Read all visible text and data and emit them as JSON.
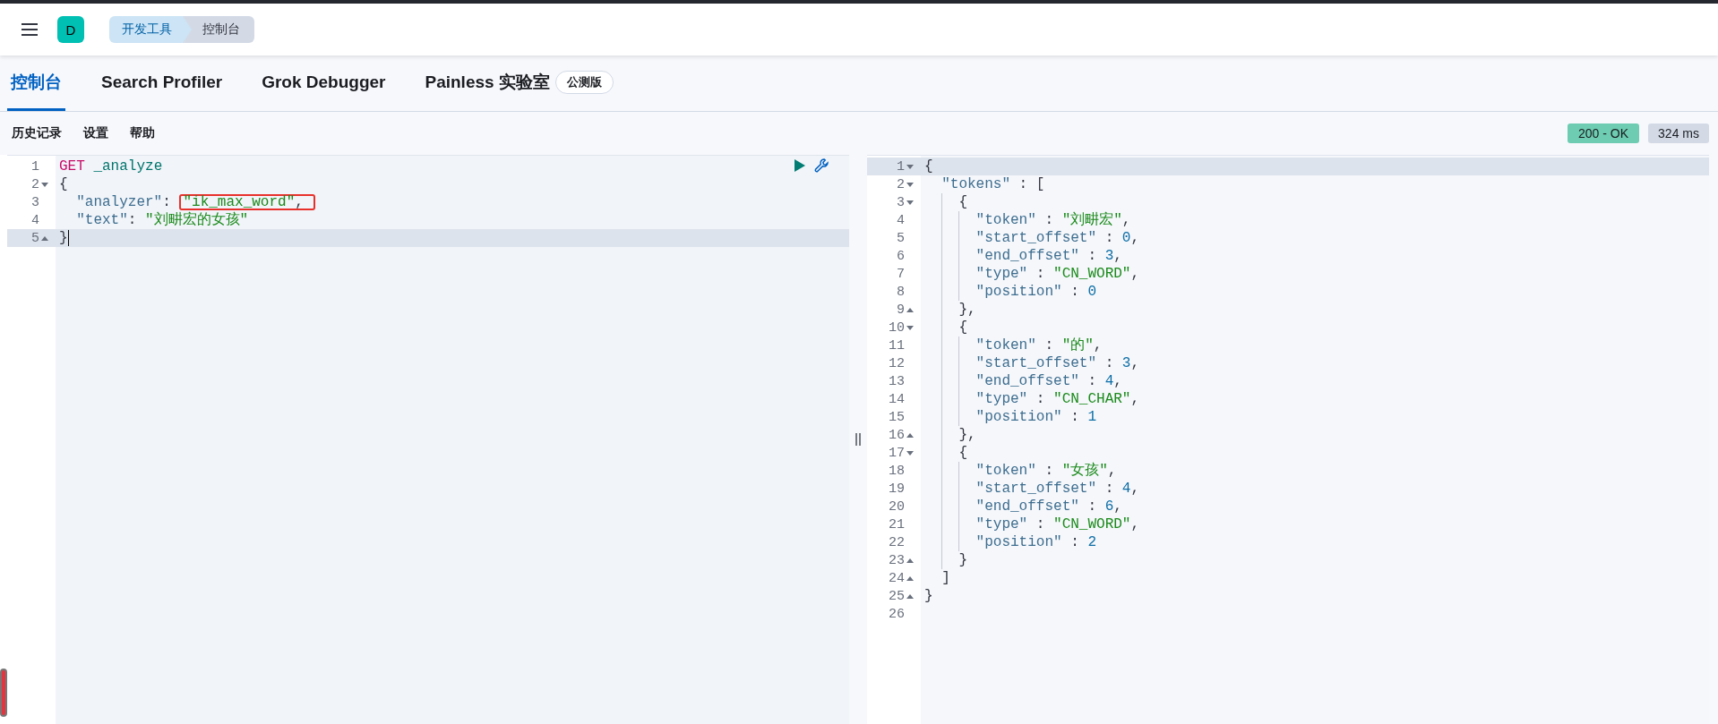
{
  "header": {
    "avatar": "D",
    "breadcrumbs": [
      {
        "label": "开发工具",
        "selected": false
      },
      {
        "label": "控制台",
        "selected": true
      }
    ]
  },
  "tabs": [
    {
      "label": "控制台",
      "selected": true
    },
    {
      "label": "Search Profiler",
      "selected": false
    },
    {
      "label": "Grok Debugger",
      "selected": false
    },
    {
      "label": "Painless 实验室",
      "selected": false,
      "badge": "公测版"
    }
  ],
  "toolbar": {
    "links": [
      "历史记录",
      "设置",
      "帮助"
    ],
    "status": "200 - OK",
    "time": "324 ms"
  },
  "request": {
    "lines": [
      {
        "number": "1",
        "fold": false,
        "active": false,
        "cursor": false,
        "tokens": [
          {
            "text": "GET",
            "kind": "method"
          },
          {
            "text": " _analyze",
            "kind": "path"
          }
        ]
      },
      {
        "number": "2",
        "fold": true,
        "block_start": true,
        "active": false,
        "cursor": false,
        "tokens": [
          {
            "text": "{",
            "kind": "punct"
          }
        ]
      },
      {
        "number": "3",
        "fold": false,
        "active": false,
        "cursor": false,
        "tokens": [
          {
            "text": "  \"analyzer\"",
            "kind": "key"
          },
          {
            "text": ": ",
            "kind": "punct"
          },
          {
            "text": "\"ik_max_word\"",
            "kind": "string",
            "boxed": true
          },
          {
            "text": ", ",
            "kind": "punct",
            "boxed": true
          }
        ]
      },
      {
        "number": "4",
        "fold": false,
        "active": false,
        "cursor": false,
        "tokens": [
          {
            "text": "  \"text\"",
            "kind": "key"
          },
          {
            "text": ": ",
            "kind": "punct"
          },
          {
            "text": "\"刘畊宏的女孩\"",
            "kind": "string"
          }
        ]
      },
      {
        "number": "5",
        "fold": true,
        "block_start": false,
        "active": true,
        "cursor": true,
        "tokens": [
          {
            "text": "}",
            "kind": "punct"
          }
        ]
      }
    ]
  },
  "response": {
    "lines": [
      {
        "number": "1",
        "fold": true,
        "block_start": true,
        "active": true,
        "tokens": [
          {
            "text": "{",
            "kind": "punct"
          }
        ]
      },
      {
        "number": "2",
        "fold": true,
        "block_start": true,
        "active": false,
        "tokens": [
          {
            "text": "  \"tokens\"",
            "kind": "key"
          },
          {
            "text": " : [",
            "kind": "punct"
          }
        ]
      },
      {
        "number": "3",
        "fold": true,
        "block_start": true,
        "active": false,
        "tokens": [
          {
            "text": "    {",
            "kind": "punct"
          }
        ]
      },
      {
        "number": "4",
        "fold": false,
        "active": false,
        "tokens": [
          {
            "text": "      \"token\"",
            "kind": "key"
          },
          {
            "text": " : ",
            "kind": "punct"
          },
          {
            "text": "\"刘畊宏\"",
            "kind": "string"
          },
          {
            "text": ",",
            "kind": "punct"
          }
        ]
      },
      {
        "number": "5",
        "fold": false,
        "active": false,
        "tokens": [
          {
            "text": "      \"start_offset\"",
            "kind": "key"
          },
          {
            "text": " : ",
            "kind": "punct"
          },
          {
            "text": "0",
            "kind": "number"
          },
          {
            "text": ",",
            "kind": "punct"
          }
        ]
      },
      {
        "number": "6",
        "fold": false,
        "active": false,
        "tokens": [
          {
            "text": "      \"end_offset\"",
            "kind": "key"
          },
          {
            "text": " : ",
            "kind": "punct"
          },
          {
            "text": "3",
            "kind": "number"
          },
          {
            "text": ",",
            "kind": "punct"
          }
        ]
      },
      {
        "number": "7",
        "fold": false,
        "active": false,
        "tokens": [
          {
            "text": "      \"type\"",
            "kind": "key"
          },
          {
            "text": " : ",
            "kind": "punct"
          },
          {
            "text": "\"CN_WORD\"",
            "kind": "string"
          },
          {
            "text": ",",
            "kind": "punct"
          }
        ]
      },
      {
        "number": "8",
        "fold": false,
        "active": false,
        "tokens": [
          {
            "text": "      \"position\"",
            "kind": "key"
          },
          {
            "text": " : ",
            "kind": "punct"
          },
          {
            "text": "0",
            "kind": "number"
          }
        ]
      },
      {
        "number": "9",
        "fold": true,
        "block_start": false,
        "active": false,
        "tokens": [
          {
            "text": "    },",
            "kind": "punct"
          }
        ]
      },
      {
        "number": "10",
        "fold": true,
        "block_start": true,
        "active": false,
        "tokens": [
          {
            "text": "    {",
            "kind": "punct"
          }
        ]
      },
      {
        "number": "11",
        "fold": false,
        "active": false,
        "tokens": [
          {
            "text": "      \"token\"",
            "kind": "key"
          },
          {
            "text": " : ",
            "kind": "punct"
          },
          {
            "text": "\"的\"",
            "kind": "string"
          },
          {
            "text": ",",
            "kind": "punct"
          }
        ]
      },
      {
        "number": "12",
        "fold": false,
        "active": false,
        "tokens": [
          {
            "text": "      \"start_offset\"",
            "kind": "key"
          },
          {
            "text": " : ",
            "kind": "punct"
          },
          {
            "text": "3",
            "kind": "number"
          },
          {
            "text": ",",
            "kind": "punct"
          }
        ]
      },
      {
        "number": "13",
        "fold": false,
        "active": false,
        "tokens": [
          {
            "text": "      \"end_offset\"",
            "kind": "key"
          },
          {
            "text": " : ",
            "kind": "punct"
          },
          {
            "text": "4",
            "kind": "number"
          },
          {
            "text": ",",
            "kind": "punct"
          }
        ]
      },
      {
        "number": "14",
        "fold": false,
        "active": false,
        "tokens": [
          {
            "text": "      \"type\"",
            "kind": "key"
          },
          {
            "text": " : ",
            "kind": "punct"
          },
          {
            "text": "\"CN_CHAR\"",
            "kind": "string"
          },
          {
            "text": ",",
            "kind": "punct"
          }
        ]
      },
      {
        "number": "15",
        "fold": false,
        "active": false,
        "tokens": [
          {
            "text": "      \"position\"",
            "kind": "key"
          },
          {
            "text": " : ",
            "kind": "punct"
          },
          {
            "text": "1",
            "kind": "number"
          }
        ]
      },
      {
        "number": "16",
        "fold": true,
        "block_start": false,
        "active": false,
        "tokens": [
          {
            "text": "    },",
            "kind": "punct"
          }
        ]
      },
      {
        "number": "17",
        "fold": true,
        "block_start": true,
        "active": false,
        "tokens": [
          {
            "text": "    {",
            "kind": "punct"
          }
        ]
      },
      {
        "number": "18",
        "fold": false,
        "active": false,
        "tokens": [
          {
            "text": "      \"token\"",
            "kind": "key"
          },
          {
            "text": " : ",
            "kind": "punct"
          },
          {
            "text": "\"女孩\"",
            "kind": "string"
          },
          {
            "text": ",",
            "kind": "punct"
          }
        ]
      },
      {
        "number": "19",
        "fold": false,
        "active": false,
        "tokens": [
          {
            "text": "      \"start_offset\"",
            "kind": "key"
          },
          {
            "text": " : ",
            "kind": "punct"
          },
          {
            "text": "4",
            "kind": "number"
          },
          {
            "text": ",",
            "kind": "punct"
          }
        ]
      },
      {
        "number": "20",
        "fold": false,
        "active": false,
        "tokens": [
          {
            "text": "      \"end_offset\"",
            "kind": "key"
          },
          {
            "text": " : ",
            "kind": "punct"
          },
          {
            "text": "6",
            "kind": "number"
          },
          {
            "text": ",",
            "kind": "punct"
          }
        ]
      },
      {
        "number": "21",
        "fold": false,
        "active": false,
        "tokens": [
          {
            "text": "      \"type\"",
            "kind": "key"
          },
          {
            "text": " : ",
            "kind": "punct"
          },
          {
            "text": "\"CN_WORD\"",
            "kind": "string"
          },
          {
            "text": ",",
            "kind": "punct"
          }
        ]
      },
      {
        "number": "22",
        "fold": false,
        "active": false,
        "tokens": [
          {
            "text": "      \"position\"",
            "kind": "key"
          },
          {
            "text": " : ",
            "kind": "punct"
          },
          {
            "text": "2",
            "kind": "number"
          }
        ]
      },
      {
        "number": "23",
        "fold": true,
        "block_start": false,
        "active": false,
        "tokens": [
          {
            "text": "    }",
            "kind": "punct"
          }
        ]
      },
      {
        "number": "24",
        "fold": true,
        "block_start": false,
        "active": false,
        "tokens": [
          {
            "text": "  ]",
            "kind": "punct"
          }
        ]
      },
      {
        "number": "25",
        "fold": true,
        "block_start": false,
        "active": false,
        "tokens": [
          {
            "text": "}",
            "kind": "punct"
          }
        ]
      },
      {
        "number": "26",
        "fold": false,
        "active": false
      }
    ]
  }
}
